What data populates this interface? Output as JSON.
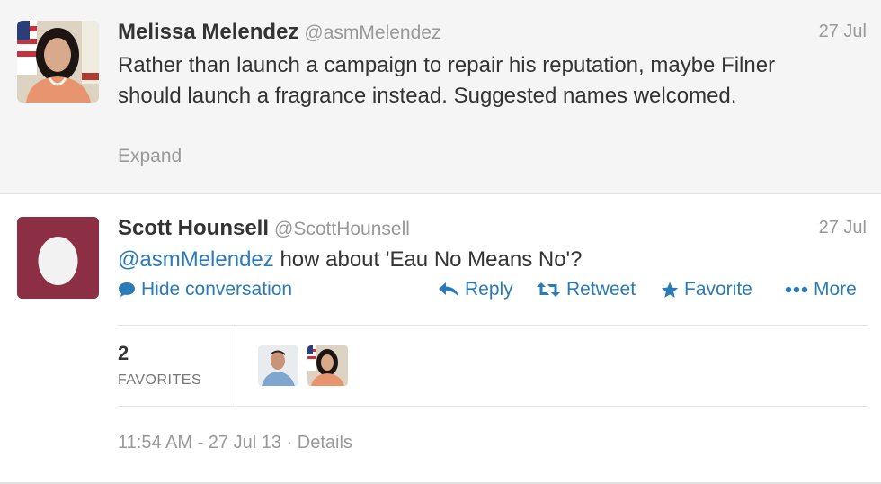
{
  "colors": {
    "link": "#2b7bb9",
    "egg_bg": "#8c2f45",
    "muted": "#999999"
  },
  "tweets": [
    {
      "name": "Melissa Melendez",
      "handle": "@asmMelendez",
      "time": "27 Jul",
      "text": "Rather than launch a campaign to repair his reputation, maybe Filner should launch a fragrance instead. Suggested names welcomed.",
      "expand_label": "Expand"
    },
    {
      "name": "Scott Hounsell",
      "handle": "@ScottHounsell",
      "time": "27 Jul",
      "mention": "@asmMelendez",
      "text": "how about 'Eau No Means No'?",
      "actions": {
        "hide_conversation": "Hide conversation",
        "reply": "Reply",
        "retweet": "Retweet",
        "favorite": "Favorite",
        "more": "More"
      },
      "stats": {
        "favorites_count": "2",
        "favorites_label": "FAVORITES"
      },
      "meta": {
        "timestamp": "11:54 AM - 27 Jul 13",
        "separator": "·",
        "details": "Details"
      }
    }
  ]
}
